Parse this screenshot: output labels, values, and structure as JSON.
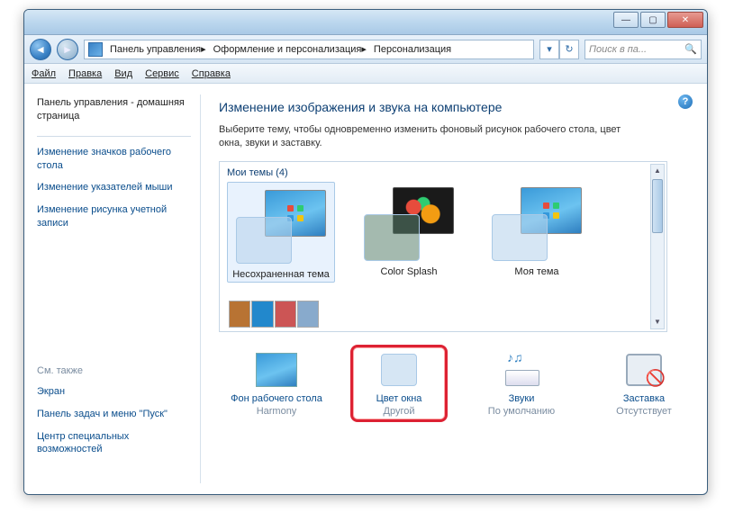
{
  "breadcrumb": {
    "seg1": "Панель управления",
    "seg2": "Оформление и персонализация",
    "seg3": "Персонализация"
  },
  "search": {
    "placeholder": "Поиск в па..."
  },
  "menubar": {
    "file": "Файл",
    "edit": "Правка",
    "view": "Вид",
    "tools": "Сервис",
    "help": "Справка"
  },
  "sidebar": {
    "home": "Панель управления - домашняя страница",
    "links": [
      "Изменение значков рабочего стола",
      "Изменение указателей мыши",
      "Изменение рисунка учетной записи"
    ],
    "see_also_label": "См. также",
    "see_also": [
      "Экран",
      "Панель задач и меню \"Пуск\"",
      "Центр специальных возможностей"
    ]
  },
  "main": {
    "heading": "Изменение изображения и звука на компьютере",
    "desc": "Выберите тему, чтобы одновременно изменить фоновый рисунок рабочего стола, цвет окна, звуки и заставку.",
    "themes_header": "Мои темы (4)",
    "themes": [
      {
        "name": "Несохраненная тема"
      },
      {
        "name": "Color Splash"
      },
      {
        "name": "Моя тема"
      }
    ],
    "options": {
      "wallpaper": {
        "label": "Фон рабочего стола",
        "sub": "Harmony"
      },
      "color": {
        "label": "Цвет окна",
        "sub": "Другой"
      },
      "sounds": {
        "label": "Звуки",
        "sub": "По умолчанию"
      },
      "saver": {
        "label": "Заставка",
        "sub": "Отсутствует"
      }
    }
  }
}
